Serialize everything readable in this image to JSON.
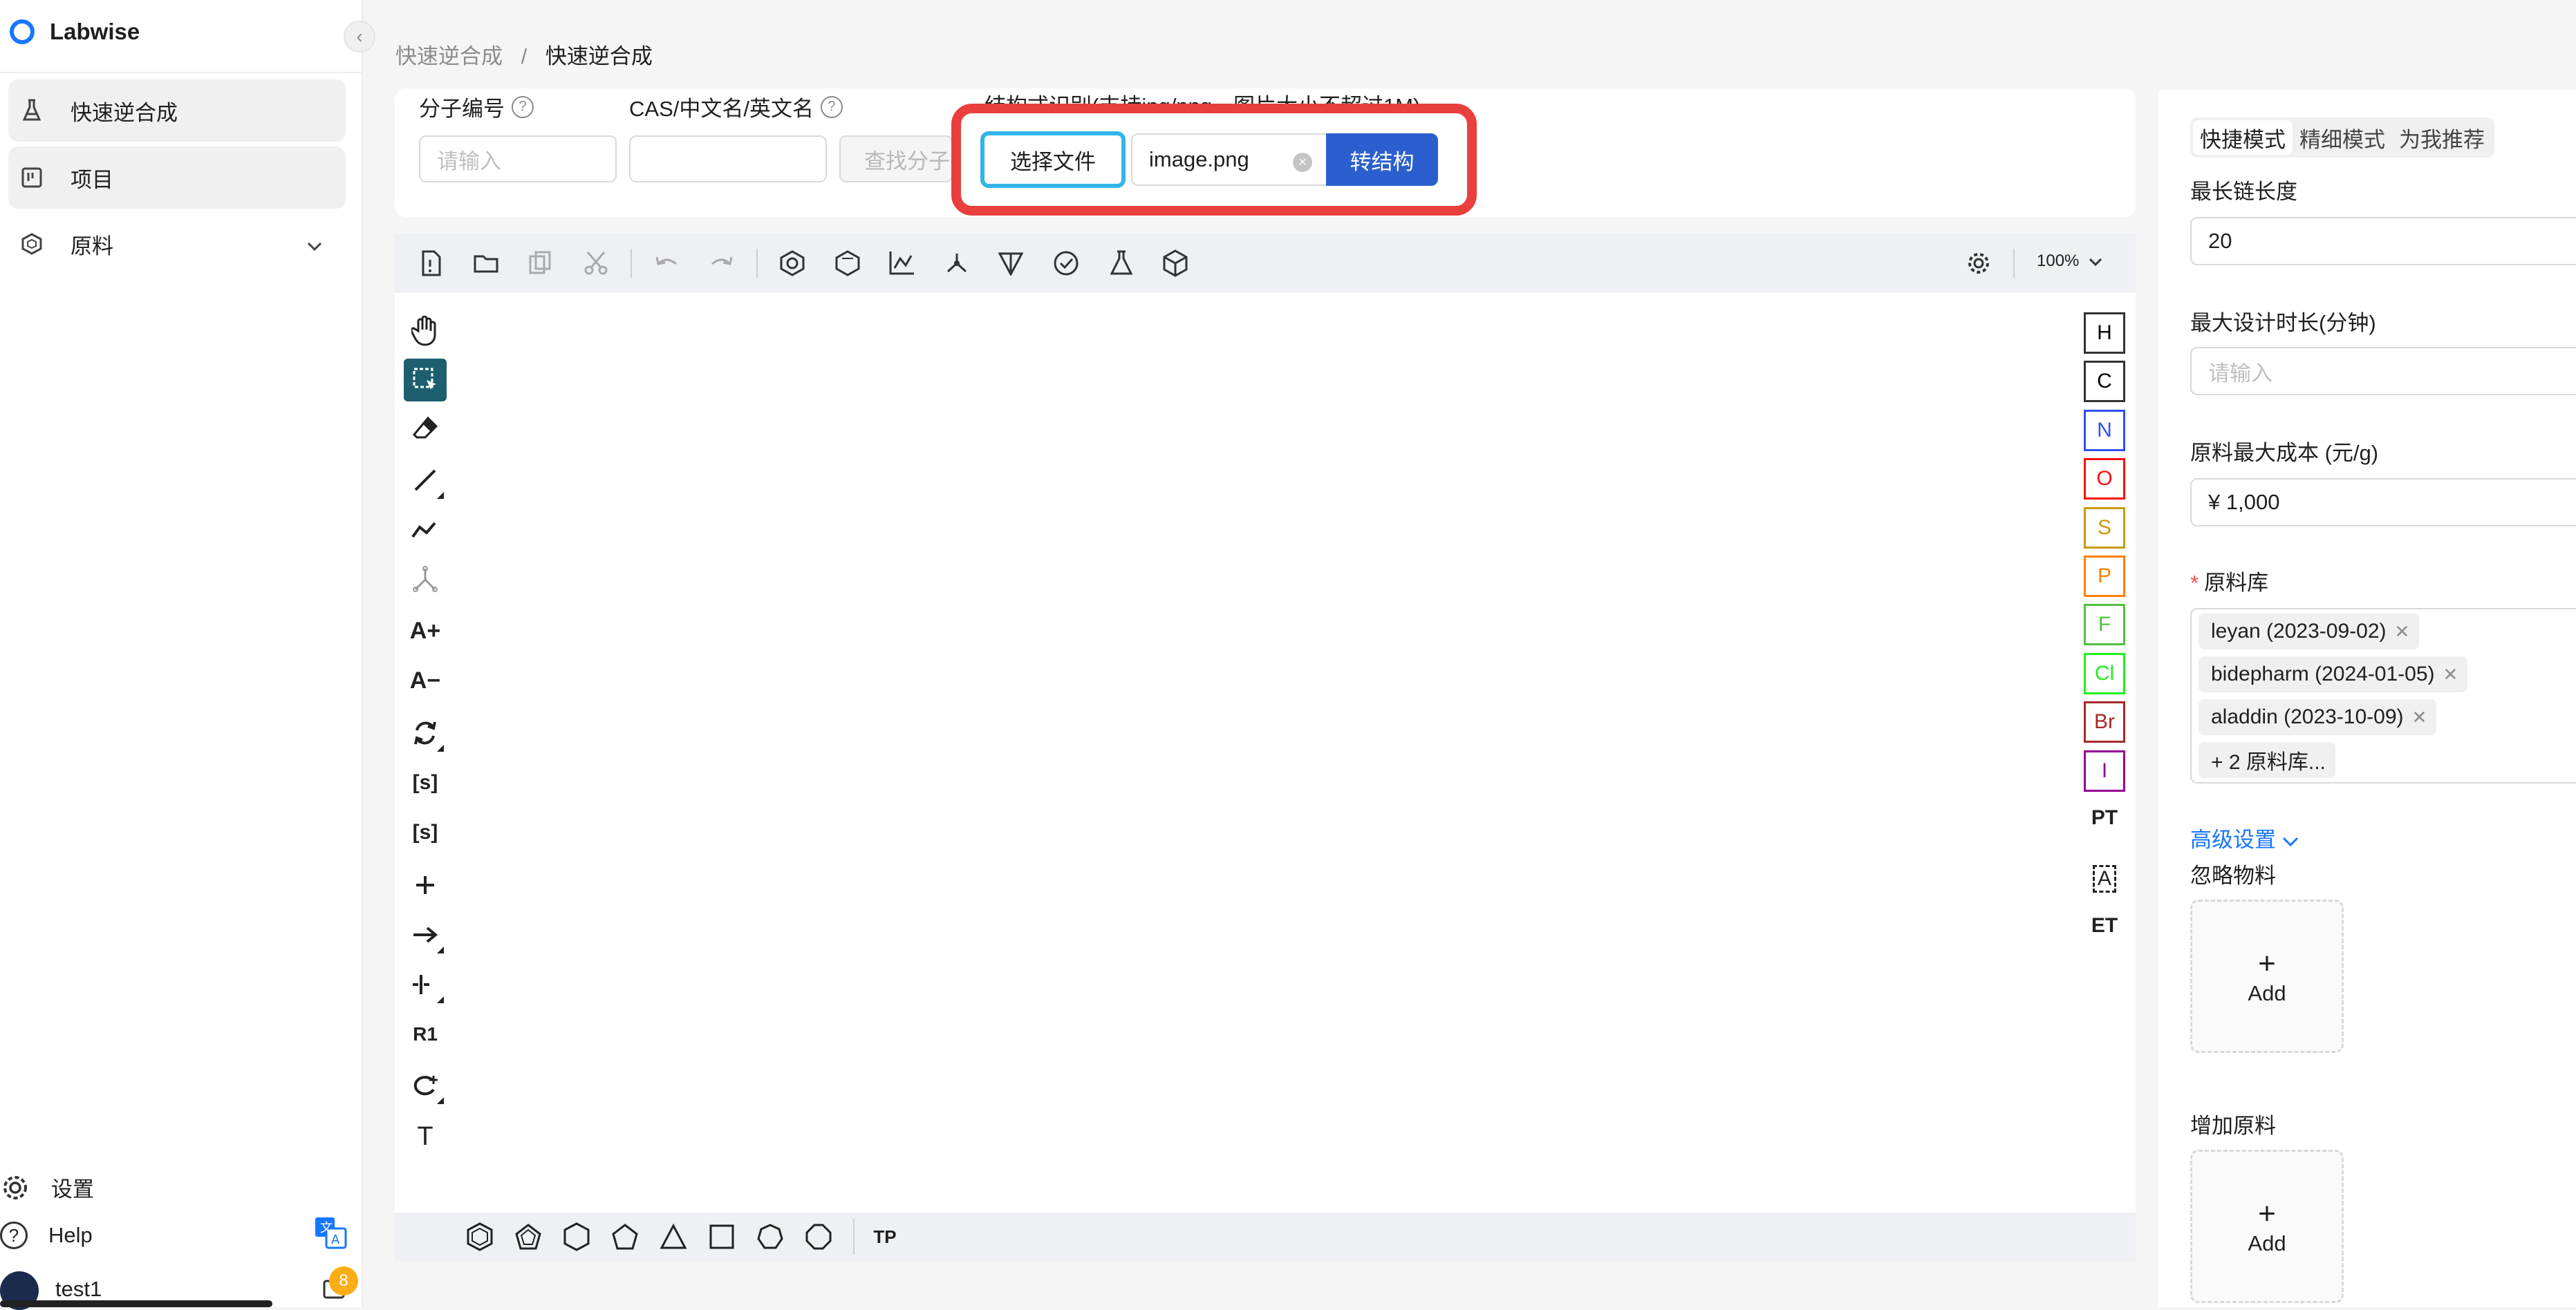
{
  "app": {
    "name": "Labwise"
  },
  "sidebar": {
    "items": [
      {
        "label": "快速逆合成",
        "icon": "flask-icon",
        "active": true
      },
      {
        "label": "项目",
        "icon": "project-icon",
        "active": true
      },
      {
        "label": "原料",
        "icon": "hexagon-icon",
        "active": false
      }
    ],
    "bottom": {
      "settings_label": "设置",
      "help_label": "Help",
      "user_name": "test1",
      "notification_count": "8"
    }
  },
  "breadcrumb": {
    "parent": "快速逆合成",
    "separator": "/",
    "current": "快速逆合成"
  },
  "search": {
    "molecule_id_label": "分子编号",
    "molecule_id_placeholder": "请输入",
    "cas_label": "CAS/中文名/英文名",
    "cas_value": "",
    "find_button": "查找分子",
    "recognition_label": "结构式识别(支持jpg/png，图片大小不超过1M)",
    "choose_file_button": "选择文件",
    "file_name": "image.png",
    "convert_button": "转结构"
  },
  "editor": {
    "zoom": "100%",
    "elements": [
      "H",
      "C",
      "N",
      "O",
      "S",
      "P",
      "F",
      "Cl",
      "Br",
      "I"
    ],
    "element_colors": {
      "H": "#000000",
      "C": "#000000",
      "N": "#3050f8",
      "O": "#ff0d0d",
      "S": "#c99a10",
      "P": "#ff8000",
      "F": "#50c040",
      "Cl": "#1ff01f",
      "Br": "#a62929",
      "I": "#940094"
    },
    "extra_tools": [
      "PT",
      "A",
      "ET"
    ],
    "bottom_extra": "TP",
    "left_text_tools": [
      "A+",
      "A−",
      "[s]",
      "[s]",
      "R1",
      "T"
    ]
  },
  "settings": {
    "modes": [
      "快捷模式",
      "精细模式",
      "为我推荐"
    ],
    "max_chain_label": "最长链长度",
    "max_chain_value": "20",
    "max_time_label": "最大设计时长(分钟)",
    "max_time_placeholder": "请输入",
    "max_cost_label": "原料最大成本 (元/g)",
    "max_cost_value": "¥ 1,000",
    "library_label": "原料库",
    "libraries": [
      "leyan (2023-09-02)",
      "bidepharm (2024-01-05)",
      "aladdin (2023-10-09)"
    ],
    "more_libraries": "+ 2 原料库...",
    "advanced_label": "高级设置",
    "ignore_label": "忽略物料",
    "add_label": "Add",
    "add_material_label": "增加原料"
  },
  "colors": {
    "accent": "#2b5fcf",
    "highlight": "#e9403d",
    "file_border": "#33b5e8"
  }
}
